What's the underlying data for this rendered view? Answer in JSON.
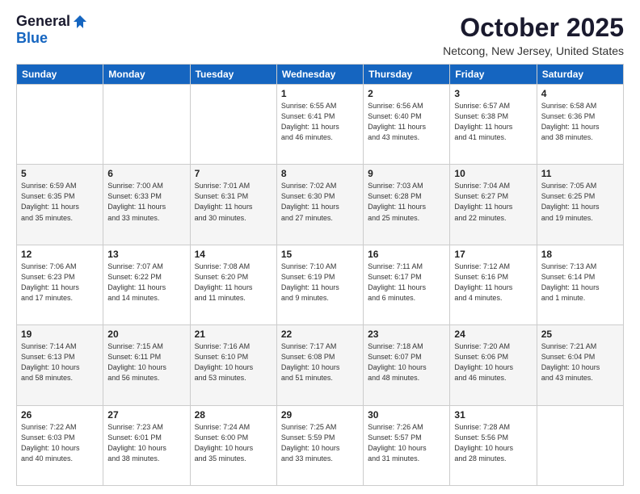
{
  "header": {
    "logo_general": "General",
    "logo_blue": "Blue",
    "title": "October 2025",
    "location": "Netcong, New Jersey, United States"
  },
  "days_of_week": [
    "Sunday",
    "Monday",
    "Tuesday",
    "Wednesday",
    "Thursday",
    "Friday",
    "Saturday"
  ],
  "weeks": [
    [
      {
        "day": "",
        "info": ""
      },
      {
        "day": "",
        "info": ""
      },
      {
        "day": "",
        "info": ""
      },
      {
        "day": "1",
        "info": "Sunrise: 6:55 AM\nSunset: 6:41 PM\nDaylight: 11 hours\nand 46 minutes."
      },
      {
        "day": "2",
        "info": "Sunrise: 6:56 AM\nSunset: 6:40 PM\nDaylight: 11 hours\nand 43 minutes."
      },
      {
        "day": "3",
        "info": "Sunrise: 6:57 AM\nSunset: 6:38 PM\nDaylight: 11 hours\nand 41 minutes."
      },
      {
        "day": "4",
        "info": "Sunrise: 6:58 AM\nSunset: 6:36 PM\nDaylight: 11 hours\nand 38 minutes."
      }
    ],
    [
      {
        "day": "5",
        "info": "Sunrise: 6:59 AM\nSunset: 6:35 PM\nDaylight: 11 hours\nand 35 minutes."
      },
      {
        "day": "6",
        "info": "Sunrise: 7:00 AM\nSunset: 6:33 PM\nDaylight: 11 hours\nand 33 minutes."
      },
      {
        "day": "7",
        "info": "Sunrise: 7:01 AM\nSunset: 6:31 PM\nDaylight: 11 hours\nand 30 minutes."
      },
      {
        "day": "8",
        "info": "Sunrise: 7:02 AM\nSunset: 6:30 PM\nDaylight: 11 hours\nand 27 minutes."
      },
      {
        "day": "9",
        "info": "Sunrise: 7:03 AM\nSunset: 6:28 PM\nDaylight: 11 hours\nand 25 minutes."
      },
      {
        "day": "10",
        "info": "Sunrise: 7:04 AM\nSunset: 6:27 PM\nDaylight: 11 hours\nand 22 minutes."
      },
      {
        "day": "11",
        "info": "Sunrise: 7:05 AM\nSunset: 6:25 PM\nDaylight: 11 hours\nand 19 minutes."
      }
    ],
    [
      {
        "day": "12",
        "info": "Sunrise: 7:06 AM\nSunset: 6:23 PM\nDaylight: 11 hours\nand 17 minutes."
      },
      {
        "day": "13",
        "info": "Sunrise: 7:07 AM\nSunset: 6:22 PM\nDaylight: 11 hours\nand 14 minutes."
      },
      {
        "day": "14",
        "info": "Sunrise: 7:08 AM\nSunset: 6:20 PM\nDaylight: 11 hours\nand 11 minutes."
      },
      {
        "day": "15",
        "info": "Sunrise: 7:10 AM\nSunset: 6:19 PM\nDaylight: 11 hours\nand 9 minutes."
      },
      {
        "day": "16",
        "info": "Sunrise: 7:11 AM\nSunset: 6:17 PM\nDaylight: 11 hours\nand 6 minutes."
      },
      {
        "day": "17",
        "info": "Sunrise: 7:12 AM\nSunset: 6:16 PM\nDaylight: 11 hours\nand 4 minutes."
      },
      {
        "day": "18",
        "info": "Sunrise: 7:13 AM\nSunset: 6:14 PM\nDaylight: 11 hours\nand 1 minute."
      }
    ],
    [
      {
        "day": "19",
        "info": "Sunrise: 7:14 AM\nSunset: 6:13 PM\nDaylight: 10 hours\nand 58 minutes."
      },
      {
        "day": "20",
        "info": "Sunrise: 7:15 AM\nSunset: 6:11 PM\nDaylight: 10 hours\nand 56 minutes."
      },
      {
        "day": "21",
        "info": "Sunrise: 7:16 AM\nSunset: 6:10 PM\nDaylight: 10 hours\nand 53 minutes."
      },
      {
        "day": "22",
        "info": "Sunrise: 7:17 AM\nSunset: 6:08 PM\nDaylight: 10 hours\nand 51 minutes."
      },
      {
        "day": "23",
        "info": "Sunrise: 7:18 AM\nSunset: 6:07 PM\nDaylight: 10 hours\nand 48 minutes."
      },
      {
        "day": "24",
        "info": "Sunrise: 7:20 AM\nSunset: 6:06 PM\nDaylight: 10 hours\nand 46 minutes."
      },
      {
        "day": "25",
        "info": "Sunrise: 7:21 AM\nSunset: 6:04 PM\nDaylight: 10 hours\nand 43 minutes."
      }
    ],
    [
      {
        "day": "26",
        "info": "Sunrise: 7:22 AM\nSunset: 6:03 PM\nDaylight: 10 hours\nand 40 minutes."
      },
      {
        "day": "27",
        "info": "Sunrise: 7:23 AM\nSunset: 6:01 PM\nDaylight: 10 hours\nand 38 minutes."
      },
      {
        "day": "28",
        "info": "Sunrise: 7:24 AM\nSunset: 6:00 PM\nDaylight: 10 hours\nand 35 minutes."
      },
      {
        "day": "29",
        "info": "Sunrise: 7:25 AM\nSunset: 5:59 PM\nDaylight: 10 hours\nand 33 minutes."
      },
      {
        "day": "30",
        "info": "Sunrise: 7:26 AM\nSunset: 5:57 PM\nDaylight: 10 hours\nand 31 minutes."
      },
      {
        "day": "31",
        "info": "Sunrise: 7:28 AM\nSunset: 5:56 PM\nDaylight: 10 hours\nand 28 minutes."
      },
      {
        "day": "",
        "info": ""
      }
    ]
  ]
}
